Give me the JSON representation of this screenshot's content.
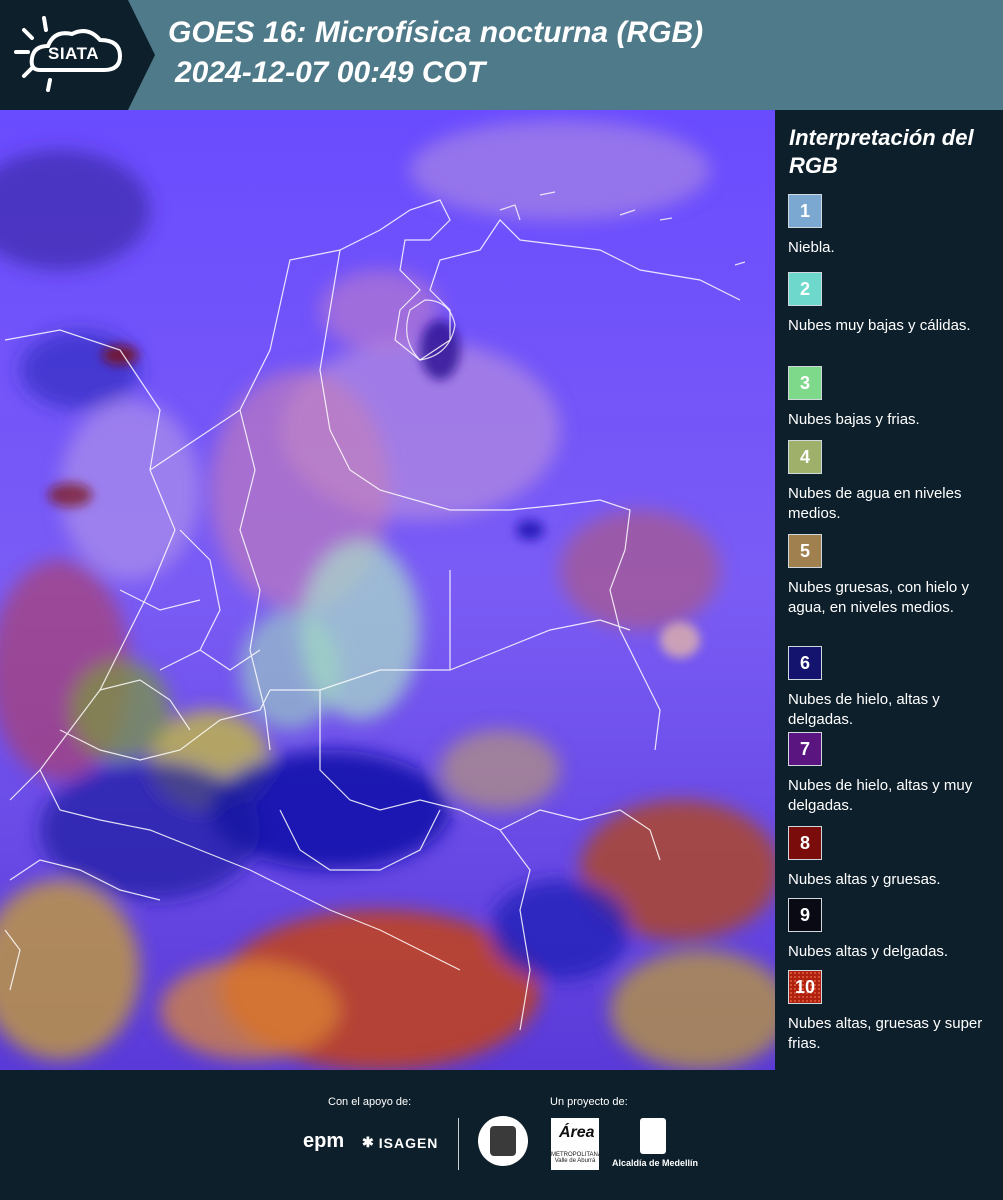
{
  "header": {
    "logo_text": "SIATA",
    "title_line1": "GOES 16: Microfísica nocturna (RGB)",
    "title_line2": "2024-12-07 00:49 COT"
  },
  "legend": {
    "title": "Interpretación del RGB",
    "items": [
      {
        "number": "1",
        "color": "#7aa8d0",
        "description": "Niebla."
      },
      {
        "number": "2",
        "color": "#6fd8cc",
        "description": "Nubes muy bajas y cálidas."
      },
      {
        "number": "3",
        "color": "#7fd98a",
        "description": "Nubes bajas y frias."
      },
      {
        "number": "4",
        "color": "#9fb06a",
        "description": "Nubes de agua en niveles medios."
      },
      {
        "number": "5",
        "color": "#a0804e",
        "description": "Nubes gruesas, con hielo y agua, en niveles medios."
      },
      {
        "number": "6",
        "color": "#14146e",
        "description": "Nubes de hielo, altas y delgadas."
      },
      {
        "number": "7",
        "color": "#5b1580",
        "description": "Nubes de hielo, altas y muy delgadas."
      },
      {
        "number": "8",
        "color": "#7a0c0c",
        "description": "Nubes altas y gruesas."
      },
      {
        "number": "9",
        "color": "#0a0a14",
        "description": "Nubes altas y delgadas."
      },
      {
        "number": "10",
        "color": "#b0200e",
        "description": "Nubes altas, gruesas y super frias."
      }
    ]
  },
  "footer": {
    "support_label": "Con el apoyo de:",
    "project_label": "Un proyecto de:",
    "sponsor_1": "epm",
    "sponsor_2": "ISAGEN",
    "area_logo_word": "Área",
    "area_logo_sub": "METROPOLITANA Valle de Aburrá",
    "medellin_label": "Alcaldía de Medellín"
  }
}
